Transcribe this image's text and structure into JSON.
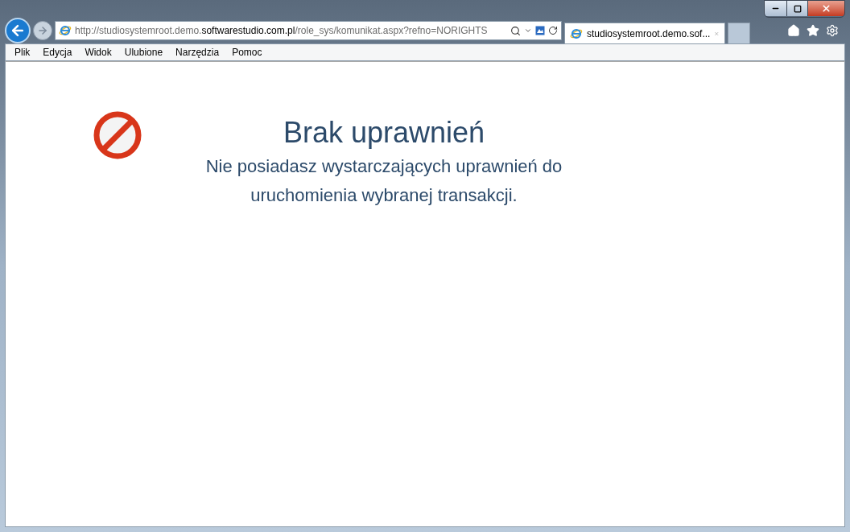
{
  "address_bar": {
    "url_prefix": "http://studiosystemroot.demo.",
    "url_domain": "softwarestudio.com.pl",
    "url_suffix": "/role_sys/komunikat.aspx?refno=NORIGHTS"
  },
  "tabs": [
    {
      "label": "studiosystemroot.demo.sof...",
      "selected": true
    }
  ],
  "menu": [
    "Plik",
    "Edycja",
    "Widok",
    "Ulubione",
    "Narzędzia",
    "Pomoc"
  ],
  "page": {
    "title": "Brak uprawnień",
    "message": "Nie posiadasz wystarczających uprawnień do uruchomienia wybranej transakcji."
  }
}
